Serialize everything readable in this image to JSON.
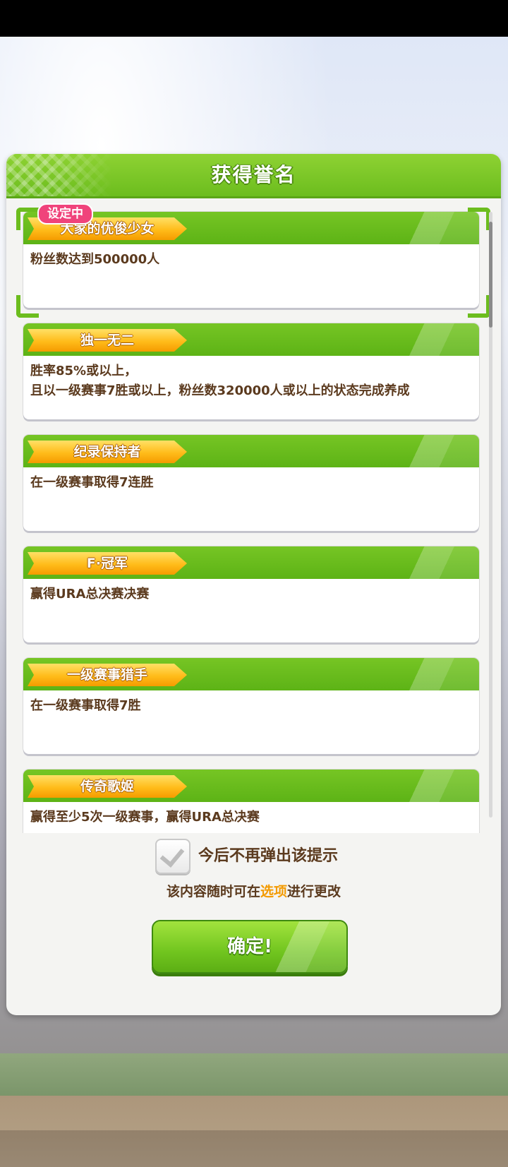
{
  "dialog": {
    "title": "获得誉名"
  },
  "current_tag": "设定中",
  "titles": [
    {
      "name": "大家的优俊少女",
      "description": "粉丝数达到500000人",
      "selected": true
    },
    {
      "name": "独一无二",
      "description": "胜率85%或以上，\n且以一级赛事7胜或以上，粉丝数320000人或以上的状态完成养成",
      "selected": false
    },
    {
      "name": "纪录保持者",
      "description": "在一级赛事取得7连胜",
      "selected": false
    },
    {
      "name": "F·冠军",
      "description": "赢得URA总决赛决赛",
      "selected": false
    },
    {
      "name": "一级赛事猎手",
      "description": "在一级赛事取得7胜",
      "selected": false
    },
    {
      "name": "传奇歌姬",
      "description": "赢得至少5次一级赛事，赢得URA总决赛",
      "selected": false
    }
  ],
  "footer": {
    "dont_show_again": "今后不再弹出该提示",
    "note_prefix": "该内容随时可在",
    "note_link": "选项",
    "note_suffix": "进行更改",
    "confirm_label": "确定!"
  },
  "colors": {
    "header_green": "#6cbd1e",
    "ribbon_orange": "#ffbc1a",
    "text_brown": "#5b3a1e",
    "tag_pink": "#f0437b",
    "link_orange": "#f39a00"
  }
}
